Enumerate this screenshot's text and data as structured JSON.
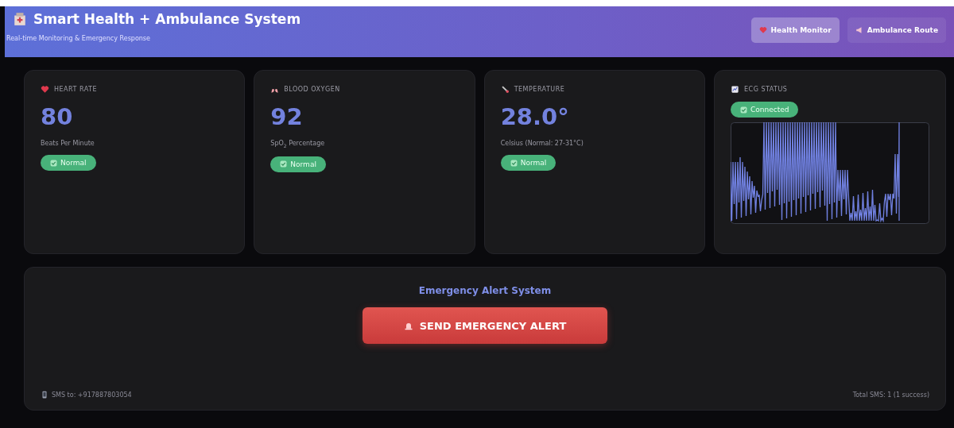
{
  "header": {
    "title": "Smart Health + Ambulance System",
    "subtitle": "Real-time Monitoring & Emergency Response"
  },
  "tabs": [
    {
      "label": "Health Monitor",
      "selected": true
    },
    {
      "label": "Ambulance Route",
      "selected": false
    }
  ],
  "cards": [
    {
      "kind": "metric",
      "label": "HEART RATE",
      "value": "80",
      "unit": "Beats Per Minute",
      "badge": "Normal"
    },
    {
      "kind": "metric",
      "label": "BLOOD OXYGEN",
      "value": "92",
      "unit": "SpO$_{2}$ Percentage",
      "badge": "Normal"
    },
    {
      "kind": "metric",
      "label": "TEMPERATURE",
      "value": "28.0°",
      "unit": "Celsius (Normal: 27-31°C)",
      "badge": "Normal"
    },
    {
      "kind": "ecg",
      "label": "ECG STATUS",
      "badge": "Connected"
    }
  ],
  "emergency": {
    "title": "Emergency Alert System",
    "button": "SEND EMERGENCY ALERT",
    "sms_to": "SMS to: +917887803054",
    "total": "Total SMS: 1 (1 success)"
  }
}
